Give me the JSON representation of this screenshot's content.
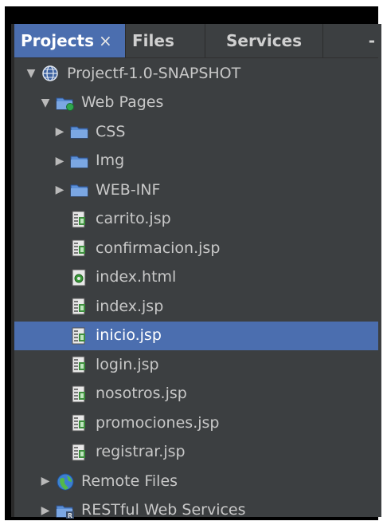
{
  "tabs": {
    "projects": "Projects",
    "projects_close": "×",
    "files": "Files",
    "services": "Services",
    "overflow": "-"
  },
  "tree": {
    "root": "Projectf-1.0-SNAPSHOT",
    "web_pages": "Web Pages",
    "folders": [
      "CSS",
      "Img",
      "WEB-INF"
    ],
    "files": [
      "carrito.jsp",
      "confirmacion.jsp",
      "index.html",
      "index.jsp",
      "inicio.jsp",
      "login.jsp",
      "nosotros.jsp",
      "promociones.jsp",
      "registrar.jsp"
    ],
    "selected_file": "inicio.jsp",
    "remote_files": "Remote Files",
    "restful": "RESTful Web Services"
  },
  "colors": {
    "panel_bg": "#3c3f41",
    "selection": "#4b6eaf",
    "text": "#c8c8c8",
    "folder_blue": "#5b8fd6"
  }
}
